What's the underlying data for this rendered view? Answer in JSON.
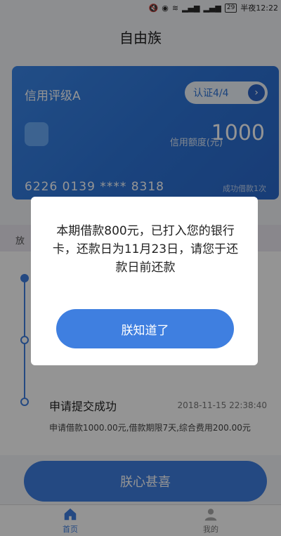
{
  "status_bar": {
    "battery": "29",
    "time": "半夜12:22"
  },
  "header": {
    "title": "自由族"
  },
  "card": {
    "rating": "信用评级A",
    "certification": "认证4/4",
    "limit_label": "信用额度(元)",
    "limit_value": "1000",
    "card_number": "6226 0139 **** 8318",
    "borrow_count": "成功借款1次"
  },
  "loan_section": {
    "strip_label": "放",
    "timeline": [
      {
        "title": "申请提交成功",
        "time": "2018-11-15 22:38:40",
        "detail": "申请借款1000.00元,借款期限7天,综合费用200.00元"
      }
    ]
  },
  "main_button": {
    "label": "朕心甚喜"
  },
  "bottom_nav": [
    {
      "label": "首页",
      "icon": "home-icon",
      "active": true
    },
    {
      "label": "我的",
      "icon": "profile-icon",
      "active": false
    }
  ],
  "dialog": {
    "message": "本期借款800元，已打入您的银行卡，还款日为11月23日，请您于还款日前还款",
    "button": "朕知道了"
  },
  "colors": {
    "primary": "#3f7fe0",
    "card_gradient_start": "#3a86e8",
    "card_gradient_end": "#2a69cc",
    "overlay": "rgba(0,0,0,0.42)"
  }
}
